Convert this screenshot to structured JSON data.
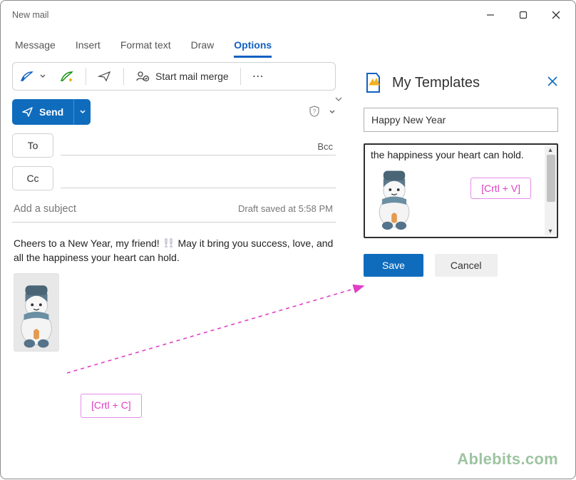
{
  "window": {
    "title": "New mail"
  },
  "tabs": {
    "message": "Message",
    "insert": "Insert",
    "format": "Format text",
    "draw": "Draw",
    "options": "Options"
  },
  "ribbon": {
    "mailmerge": "Start mail merge",
    "more": "⋯"
  },
  "compose": {
    "send": "Send",
    "to": "To",
    "cc": "Cc",
    "bcc": "Bcc",
    "subject_placeholder": "Add a subject",
    "draft_status": "Draft saved at 5:58 PM",
    "body_line1_a": "Cheers to a New Year, my friend! ",
    "body_line1_b": " May it bring you success, love, and all the happiness your heart can hold.",
    "hint_copy": "[Crtl + C]"
  },
  "templates": {
    "title": "My Templates",
    "name_value": "Happy New Year",
    "body_line": "the happiness your heart can hold.",
    "hint_paste": "[Crtl + V]",
    "save": "Save",
    "cancel": "Cancel"
  },
  "watermark": {
    "text": "Ablebits.com"
  }
}
